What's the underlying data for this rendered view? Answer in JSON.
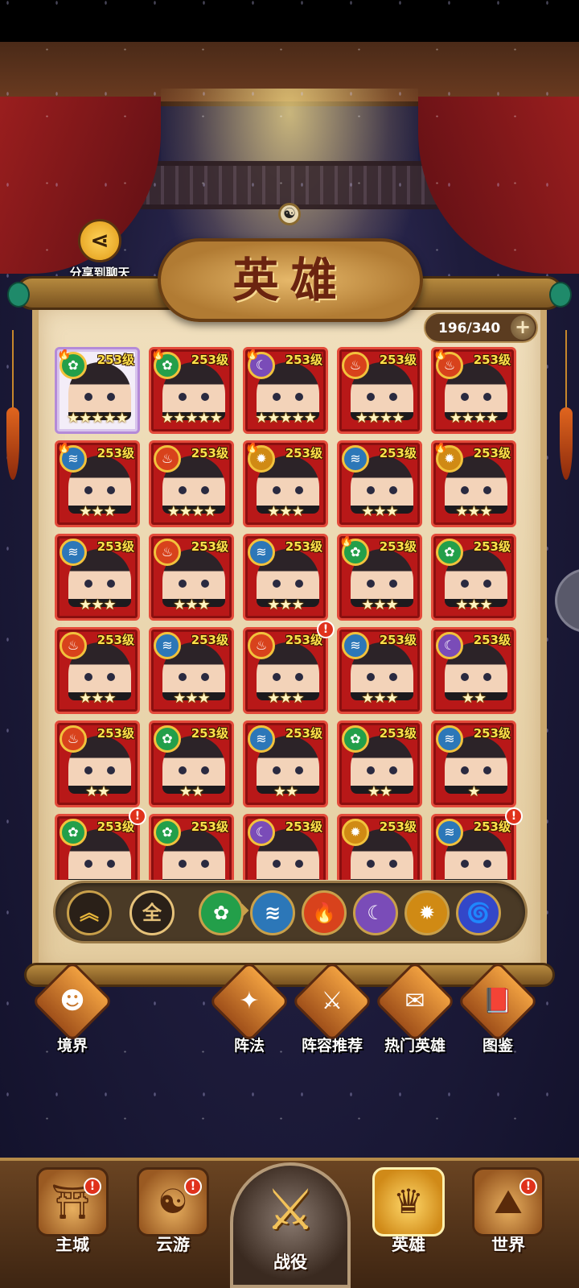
{
  "share": {
    "label": "分享到聊天"
  },
  "title": "英雄",
  "hero_count": "196/340",
  "heroes": [
    {
      "level": "253级",
      "element": "wind",
      "stars": "★★★★★",
      "crown": true,
      "selected": true
    },
    {
      "level": "253级",
      "element": "wind",
      "stars": "★★★★★",
      "crown": true
    },
    {
      "level": "253级",
      "element": "moon",
      "stars": "★★★★★",
      "crown": true
    },
    {
      "level": "253级",
      "element": "fire",
      "stars": "★★★★"
    },
    {
      "level": "253级",
      "element": "fire",
      "stars": "★★★★",
      "crown": true
    },
    {
      "level": "253级",
      "element": "water",
      "stars": "★★★",
      "crown": true
    },
    {
      "level": "253级",
      "element": "fire",
      "stars": "★★★★"
    },
    {
      "level": "253级",
      "element": "sun",
      "stars": "★★★",
      "crown": true
    },
    {
      "level": "253级",
      "element": "water",
      "stars": "★★★"
    },
    {
      "level": "253级",
      "element": "sun",
      "stars": "★★★",
      "crown": true
    },
    {
      "level": "253级",
      "element": "water",
      "stars": "★★★"
    },
    {
      "level": "253级",
      "element": "fire",
      "stars": "★★★"
    },
    {
      "level": "253级",
      "element": "water",
      "stars": "★★★"
    },
    {
      "level": "253级",
      "element": "wind",
      "stars": "★★★",
      "crown": true
    },
    {
      "level": "253级",
      "element": "wind",
      "stars": "★★★"
    },
    {
      "level": "253级",
      "element": "fire",
      "stars": "★★★"
    },
    {
      "level": "253级",
      "element": "water",
      "stars": "★★★"
    },
    {
      "level": "253级",
      "element": "fire",
      "stars": "★★★",
      "alert": true
    },
    {
      "level": "253级",
      "element": "water",
      "stars": "★★★"
    },
    {
      "level": "253级",
      "element": "moon",
      "stars": "★★"
    },
    {
      "level": "253级",
      "element": "fire",
      "stars": "★★"
    },
    {
      "level": "253级",
      "element": "wind",
      "stars": "★★"
    },
    {
      "level": "253级",
      "element": "water",
      "stars": "★★"
    },
    {
      "level": "253级",
      "element": "wind",
      "stars": "★★"
    },
    {
      "level": "253级",
      "element": "water",
      "stars": "★"
    },
    {
      "level": "253级",
      "element": "wind",
      "stars": "",
      "alert": true
    },
    {
      "level": "253级",
      "element": "wind",
      "stars": ""
    },
    {
      "level": "253级",
      "element": "moon",
      "stars": ""
    },
    {
      "level": "253级",
      "element": "sun",
      "stars": ""
    },
    {
      "level": "253级",
      "element": "water",
      "stars": "",
      "alert": true
    }
  ],
  "filters": {
    "up": "︽",
    "all": "全",
    "elements": [
      {
        "name": "wind",
        "glyph": "✿"
      },
      {
        "name": "water",
        "glyph": "≋"
      },
      {
        "name": "fire",
        "glyph": "🔥"
      },
      {
        "name": "moon",
        "glyph": "☾"
      },
      {
        "name": "sun",
        "glyph": "✹"
      },
      {
        "name": "thunder",
        "glyph": "🌀"
      }
    ]
  },
  "functions": {
    "realm": "境界",
    "formation": "阵法",
    "lineup": "阵容推荐",
    "hot_heroes": "热门英雄",
    "codex": "图鉴"
  },
  "nav": {
    "main_city": "主城",
    "travel": "云游",
    "battle": "战役",
    "heroes": "英雄",
    "world": "世界"
  },
  "alert_glyph": "!",
  "colors": {
    "card_red": "#b81818",
    "level_yellow": "#ffe24a",
    "gold": "#c9a04a"
  }
}
